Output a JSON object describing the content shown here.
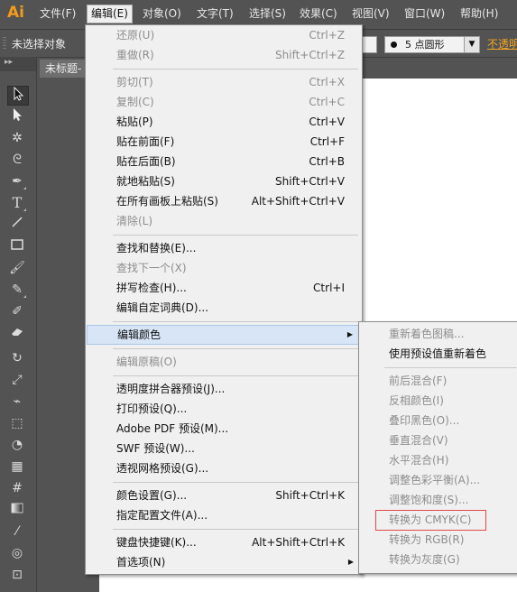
{
  "app": {
    "logo": "Ai"
  },
  "menubar": {
    "items": [
      "文件(F)",
      "编辑(E)",
      "对象(O)",
      "文字(T)",
      "选择(S)",
      "效果(C)",
      "视图(V)",
      "窗口(W)",
      "帮助(H)"
    ]
  },
  "controlbar": {
    "selection_status": "未选择对象",
    "brush_size": "5",
    "brush_name": "点圆形",
    "opacity_link": "不透明"
  },
  "document": {
    "tab_title": "未标题-"
  },
  "edit_menu": {
    "items": [
      {
        "label": "还原(U)",
        "shortcut": "Ctrl+Z",
        "disabled": true
      },
      {
        "label": "重做(R)",
        "shortcut": "Shift+Ctrl+Z",
        "disabled": true
      },
      {
        "label": "剪切(T)",
        "shortcut": "Ctrl+X",
        "disabled": true
      },
      {
        "label": "复制(C)",
        "shortcut": "Ctrl+C",
        "disabled": true
      },
      {
        "label": "粘贴(P)",
        "shortcut": "Ctrl+V"
      },
      {
        "label": "贴在前面(F)",
        "shortcut": "Ctrl+F"
      },
      {
        "label": "贴在后面(B)",
        "shortcut": "Ctrl+B"
      },
      {
        "label": "就地粘贴(S)",
        "shortcut": "Shift+Ctrl+V"
      },
      {
        "label": "在所有画板上粘贴(S)",
        "shortcut": "Alt+Shift+Ctrl+V"
      },
      {
        "label": "清除(L)",
        "shortcut": "",
        "disabled": true
      },
      {
        "label": "查找和替换(E)...",
        "shortcut": ""
      },
      {
        "label": "查找下一个(X)",
        "shortcut": "",
        "disabled": true
      },
      {
        "label": "拼写检查(H)...",
        "shortcut": "Ctrl+I"
      },
      {
        "label": "编辑自定词典(D)...",
        "shortcut": ""
      },
      {
        "label": "编辑颜色",
        "shortcut": "",
        "submenu": true,
        "highlighted": true
      },
      {
        "label": "编辑原稿(O)",
        "shortcut": "",
        "disabled": true
      },
      {
        "label": "透明度拼合器预设(J)...",
        "shortcut": ""
      },
      {
        "label": "打印预设(Q)...",
        "shortcut": ""
      },
      {
        "label": "Adobe PDF 预设(M)...",
        "shortcut": ""
      },
      {
        "label": "SWF 预设(W)...",
        "shortcut": ""
      },
      {
        "label": "透视网格预设(G)...",
        "shortcut": ""
      },
      {
        "label": "颜色设置(G)...",
        "shortcut": "Shift+Ctrl+K"
      },
      {
        "label": "指定配置文件(A)...",
        "shortcut": ""
      },
      {
        "label": "键盘快捷键(K)...",
        "shortcut": "Alt+Shift+Ctrl+K"
      },
      {
        "label": "首选项(N)",
        "shortcut": "",
        "submenu": true
      }
    ]
  },
  "edit_colors_submenu": {
    "items": [
      {
        "label": "重新着色图稿...",
        "disabled": true
      },
      {
        "label": "使用预设值重新着色"
      },
      {
        "label": "前后混合(F)",
        "disabled": true
      },
      {
        "label": "反相颜色(I)",
        "disabled": true
      },
      {
        "label": "叠印黑色(O)...",
        "disabled": true
      },
      {
        "label": "垂直混合(V)",
        "disabled": true
      },
      {
        "label": "水平混合(H)",
        "disabled": true
      },
      {
        "label": "调整色彩平衡(A)...",
        "disabled": true
      },
      {
        "label": "调整饱和度(S)...",
        "disabled": true
      },
      {
        "label": "转换为 CMYK(C)",
        "disabled": true,
        "annotated": true
      },
      {
        "label": "转换为 RGB(R)",
        "disabled": true
      },
      {
        "label": "转换为灰度(G)",
        "disabled": true
      }
    ]
  },
  "colors": {
    "menu_bg": "#f0f0f0",
    "highlight": "#d7e5f6",
    "annotation_red": "#e04848",
    "logo_orange": "#f59a1b"
  },
  "tools": [
    "selection-tool",
    "direct-selection-tool",
    "magic-wand-tool",
    "lasso-tool",
    "pen-tool",
    "type-tool",
    "line-tool",
    "rectangle-tool",
    "paintbrush-tool",
    "pencil-tool",
    "blob-brush-tool",
    "eraser-tool",
    "rotate-tool",
    "scale-tool",
    "width-tool",
    "free-transform-tool",
    "shape-builder-tool",
    "perspective-grid-tool",
    "mesh-tool",
    "gradient-tool",
    "eyedropper-tool",
    "blend-tool",
    "symbol-sprayer-tool"
  ]
}
